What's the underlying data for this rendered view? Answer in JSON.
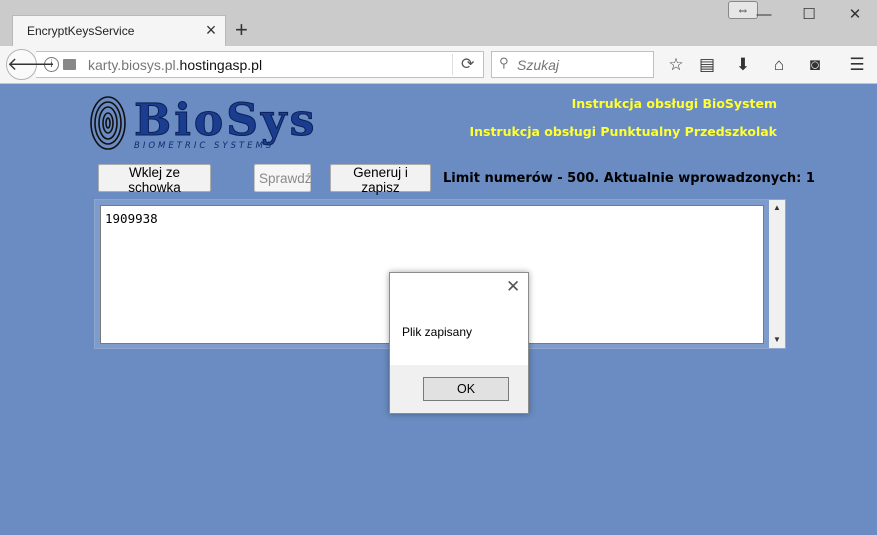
{
  "browser": {
    "tab_title": "EncryptKeysService",
    "url_prefix": "karty.biosys.pl.",
    "url_host": "hostingasp.pl",
    "search_placeholder": "Szukaj"
  },
  "page": {
    "logo_text": "BioSys",
    "logo_subtitle": "BIOMETRIC SYSTEMS",
    "links": [
      "Instrukcja obsługi BioSystem",
      "Instrukcja obsługi Punktualny Przedszkolak"
    ],
    "buttons": {
      "paste": "Wklej ze schowka",
      "check": "Sprawdź",
      "generate": "Generuj i zapisz"
    },
    "limit_text": "Limit numerów - 500. Aktualnie wprowadzonych: 1",
    "textarea_value": "1909938"
  },
  "dialog": {
    "message": "Plik zapisany",
    "ok_label": "OK"
  },
  "colors": {
    "page_bg": "#6a8cc2",
    "link_color": "#ffff33",
    "logo_blue": "#1a3d8f"
  }
}
